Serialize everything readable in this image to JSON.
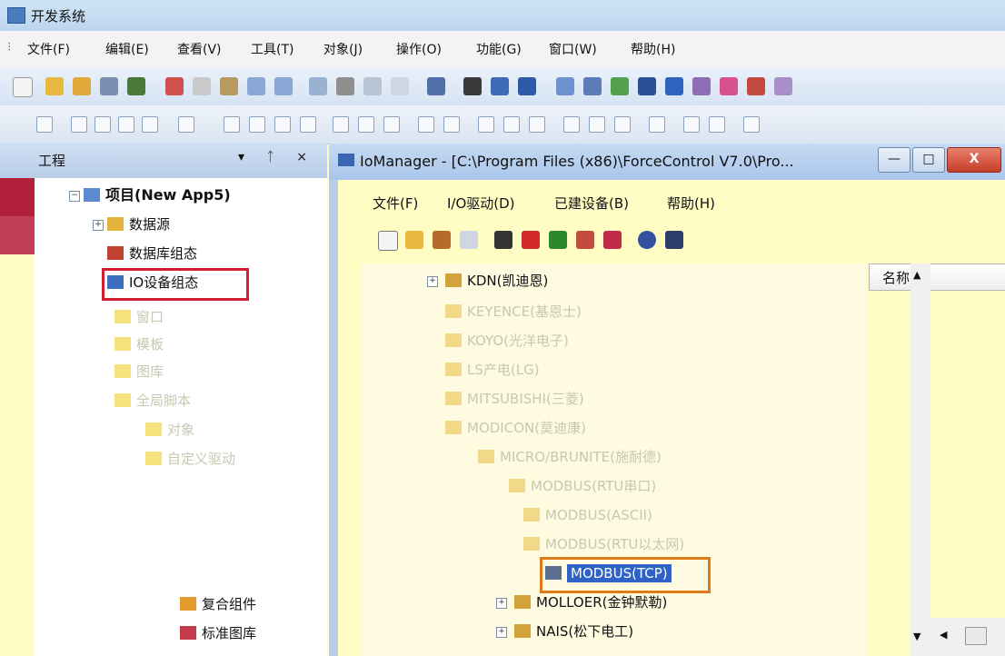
{
  "app": {
    "title": "开发系统"
  },
  "menu": [
    "文件(F)",
    "编辑(E)",
    "查看(V)",
    "工具(T)",
    "对象(J)",
    "操作(O)",
    "功能(G)",
    "窗口(W)",
    "帮助(H)"
  ],
  "left_panel": {
    "header": "工程",
    "header_controls": "▾ ᛏ ×",
    "tree": [
      {
        "label": "项目(New App5)"
      },
      {
        "label": "数据源"
      },
      {
        "label": "数据库组态"
      },
      {
        "label": "IO设备组态"
      },
      {
        "label": "窗口"
      },
      {
        "label": "模板"
      },
      {
        "label": "图库"
      },
      {
        "label": "全局脚本"
      },
      {
        "label": "对象"
      },
      {
        "label": "自定义驱动"
      },
      {
        "label": "复合组件"
      },
      {
        "label": "标准图库"
      }
    ]
  },
  "child_window": {
    "title": "IoManager - [C:\\Program Files (x86)\\ForceControl V7.0\\Pro...",
    "menu": [
      "文件(F)",
      "I/O驱动(D)",
      "已建设备(B)",
      "帮助(H)"
    ],
    "tree": [
      {
        "label": "KDN(凯迪恩)"
      },
      {
        "label": "KEYENCE(基恩士)"
      },
      {
        "label": "KOYO(光洋电子)"
      },
      {
        "label": "LS产电(LG)"
      },
      {
        "label": "MITSUBISHI(三菱)"
      },
      {
        "label": "MODICON(莫迪康)"
      },
      {
        "label": "MICRO/BRUNITE(施耐德)"
      },
      {
        "label": "MODBUS(RTU串口)"
      },
      {
        "label": "MODBUS(ASCII)"
      },
      {
        "label": "MODBUS(RTU以太网)"
      },
      {
        "label": "MODBUS(TCP)"
      },
      {
        "label": "MOLLOER(金钟默勒)"
      },
      {
        "label": "NAIS(松下电工)"
      }
    ],
    "list_header": "名称"
  },
  "colors": {
    "highlight_red": "#d21f2f",
    "selection_blue": "#2f62c7",
    "panel_yellow": "#fffdc4"
  }
}
